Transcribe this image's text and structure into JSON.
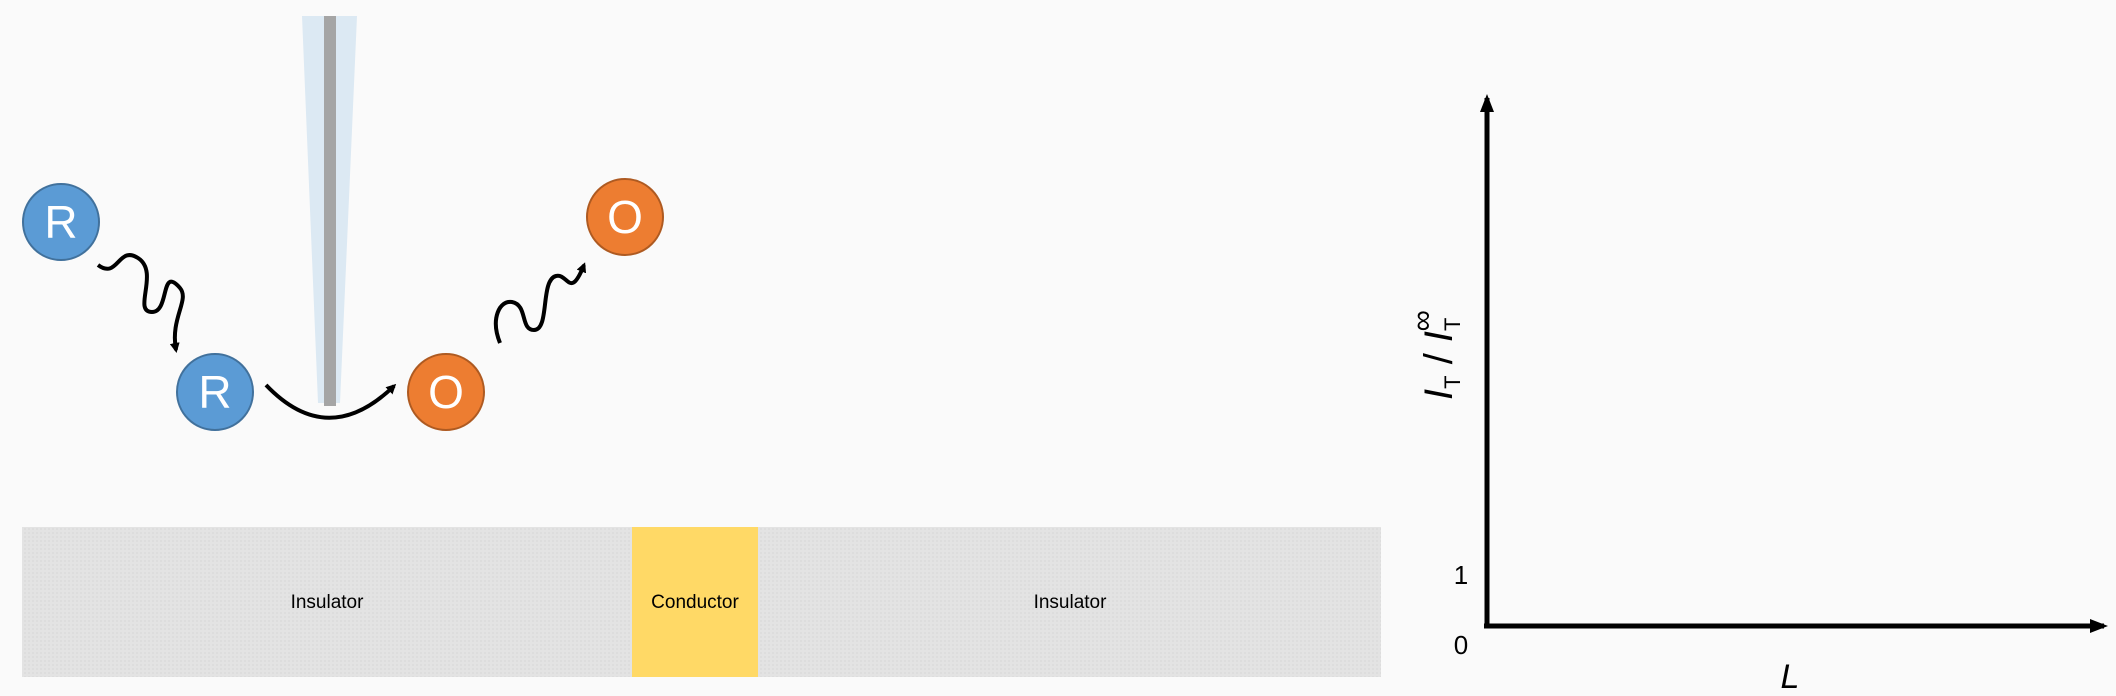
{
  "colors": {
    "background": "#fafafa",
    "reduced": "#5b9bd5",
    "reduced_stroke": "#41719c",
    "oxidized": "#ed7d31",
    "oxidized_stroke": "#ae5a21",
    "insulator": "#e3e3e3",
    "conductor": "#ffd966",
    "tip_glass": "#dce9f3",
    "tip_wire": "#a5a5a5",
    "ink": "#000000"
  },
  "species": {
    "reduced_label": "R",
    "oxidized_label": "O"
  },
  "substrate": {
    "left_label": "Insulator",
    "middle_label": "Conductor",
    "right_label": "Insulator"
  },
  "plot": {
    "y_label_main": "I",
    "y_label_sub": "T",
    "y_label_sep": " / ",
    "y_label_main2": "I",
    "y_label_sub2": "T",
    "y_label_sup2": "∞",
    "x_label": "L",
    "tick_zero": "0",
    "tick_one": "1"
  },
  "icons": {
    "diffusion_in": "wavy-arrow-icon",
    "electron_transfer": "curved-arrow-icon",
    "diffusion_out": "wavy-arrow-icon"
  }
}
